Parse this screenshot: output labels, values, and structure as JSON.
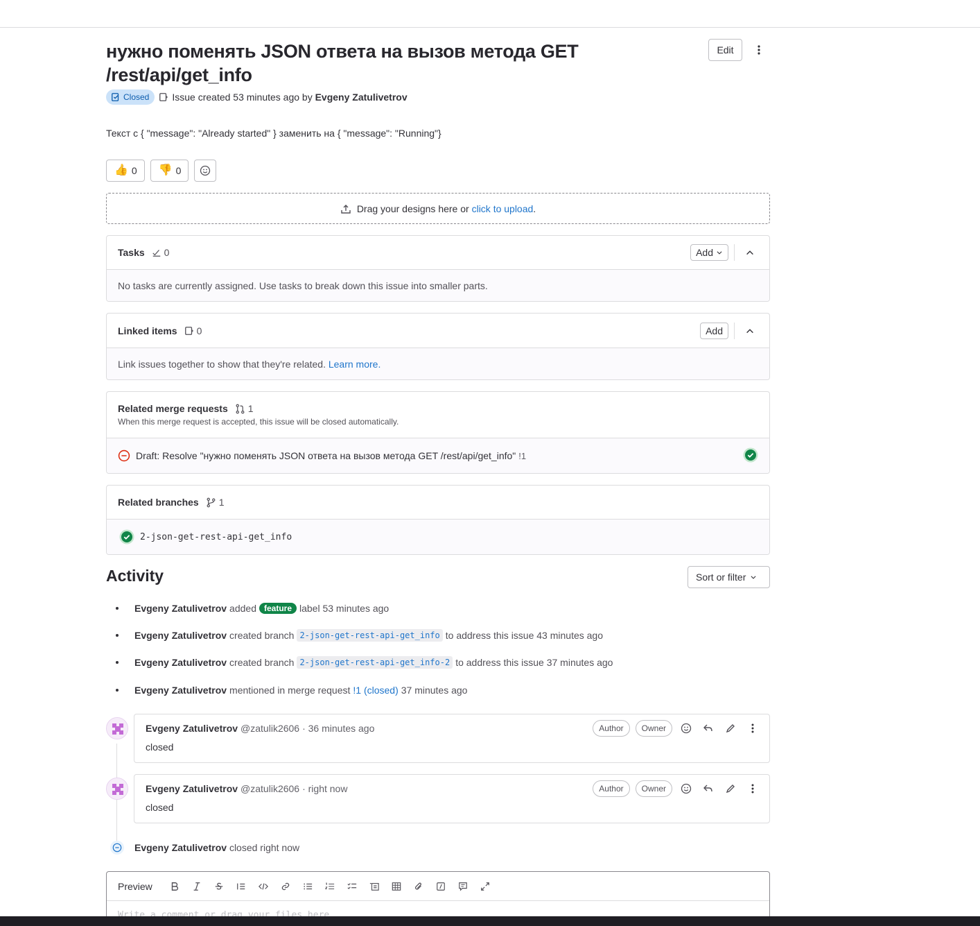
{
  "issue": {
    "title": "нужно поменять JSON ответа на вызов метода GET /rest/api/get_info",
    "status": "Closed",
    "meta_prefix": "Issue created 53 minutes ago by",
    "author": "Evgeny Zatulivetrov",
    "description": "Текст с { \"message\": \"Already started\" } заменить на { \"message\": \"Running\"}",
    "edit_label": "Edit"
  },
  "reactions": {
    "thumbs_up": "0",
    "thumbs_down": "0"
  },
  "upload": {
    "text": "Drag your designs here or",
    "link": "click to upload",
    "suffix": "."
  },
  "tasks": {
    "title": "Tasks",
    "count": "0",
    "add_label": "Add",
    "empty_text": "No tasks are currently assigned. Use tasks to break down this issue into smaller parts."
  },
  "linked": {
    "title": "Linked items",
    "count": "0",
    "add_label": "Add",
    "text": "Link issues together to show that they're related.",
    "learn_more": "Learn more."
  },
  "related_mrs": {
    "title": "Related merge requests",
    "count": "1",
    "subtitle": "When this merge request is accepted, this issue will be closed automatically.",
    "items": [
      {
        "title": "Draft: Resolve \"нужно поменять JSON ответа на вызов метода GET /rest/api/get_info\"",
        "iid": "!1"
      }
    ]
  },
  "related_branches": {
    "title": "Related branches",
    "count": "1",
    "items": [
      "2-json-get-rest-api-get_info"
    ]
  },
  "activity": {
    "title": "Activity",
    "sort_label": "Sort or filter",
    "events": [
      {
        "user": "Evgeny Zatulivetrov",
        "pre": "added",
        "label": "feature",
        "post": "label 53 minutes ago"
      },
      {
        "user": "Evgeny Zatulivetrov",
        "pre": "created branch",
        "code": "2-json-get-rest-api-get_info",
        "post": "to address this issue 43 minutes ago"
      },
      {
        "user": "Evgeny Zatulivetrov",
        "pre": "created branch",
        "code": "2-json-get-rest-api-get_info-2",
        "post": "to address this issue 37 minutes ago"
      },
      {
        "user": "Evgeny Zatulivetrov",
        "pre": "mentioned in merge request",
        "link": "!1 (closed)",
        "post": "37 minutes ago"
      }
    ],
    "notes": [
      {
        "user": "Evgeny Zatulivetrov",
        "handle": "@zatulik2606",
        "time": "· 36 minutes ago",
        "body": "closed",
        "roles": [
          "Author",
          "Owner"
        ]
      },
      {
        "user": "Evgeny Zatulivetrov",
        "handle": "@zatulik2606",
        "time": "· right now",
        "body": "closed",
        "roles": [
          "Author",
          "Owner"
        ]
      }
    ],
    "closed_event": {
      "user": "Evgeny Zatulivetrov",
      "text": "closed right now"
    }
  },
  "editor": {
    "preview_tab": "Preview",
    "placeholder": "Write a comment or drag your files here…"
  },
  "colors": {
    "link": "#1f75cb",
    "success": "#108548",
    "danger": "#dd2b0e",
    "closed_badge_bg": "#cbe2f9"
  }
}
